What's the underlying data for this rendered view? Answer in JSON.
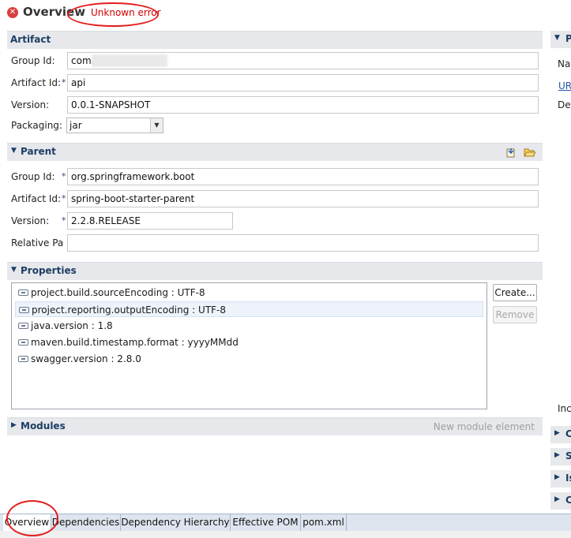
{
  "header": {
    "title": "Overview",
    "error": "Unknown error"
  },
  "artifact": {
    "title": "Artifact",
    "group_label": "Group Id:",
    "group_value": "com.",
    "artifact_label": "Artifact Id:",
    "artifact_value": "api",
    "version_label": "Version:",
    "version_value": "0.0.1-SNAPSHOT",
    "packaging_label": "Packaging:",
    "packaging_value": "jar"
  },
  "parent": {
    "title": "Parent",
    "group_label": "Group Id:",
    "group_value": "org.springframework.boot",
    "artifact_label": "Artifact Id:",
    "artifact_value": "spring-boot-starter-parent",
    "version_label": "Version:",
    "version_value": "2.2.8.RELEASE",
    "relative_label": "Relative Pa",
    "relative_value": ""
  },
  "properties": {
    "title": "Properties",
    "items": [
      "project.build.sourceEncoding : UTF-8",
      "project.reporting.outputEncoding : UTF-8",
      "java.version : 1.8",
      "maven.build.timestamp.format : yyyyMMdd",
      "swagger.version : 2.8.0"
    ],
    "create_label": "Create...",
    "remove_label": "Remove"
  },
  "modules": {
    "title": "Modules",
    "new_element": "New module element"
  },
  "right_panel": {
    "sec1": "P",
    "na": "Na",
    "ur": "UR",
    "de": "De",
    "inc": "Inc",
    "sec2": "C",
    "sec3": "S",
    "sec4": "Is",
    "sec5": "C"
  },
  "tabs": [
    "Overview",
    "Dependencies",
    "Dependency Hierarchy",
    "Effective POM",
    "pom.xml"
  ],
  "colors": {
    "accent": "#1d3e63",
    "error": "#d40000",
    "annotation": "#e41d1d"
  }
}
